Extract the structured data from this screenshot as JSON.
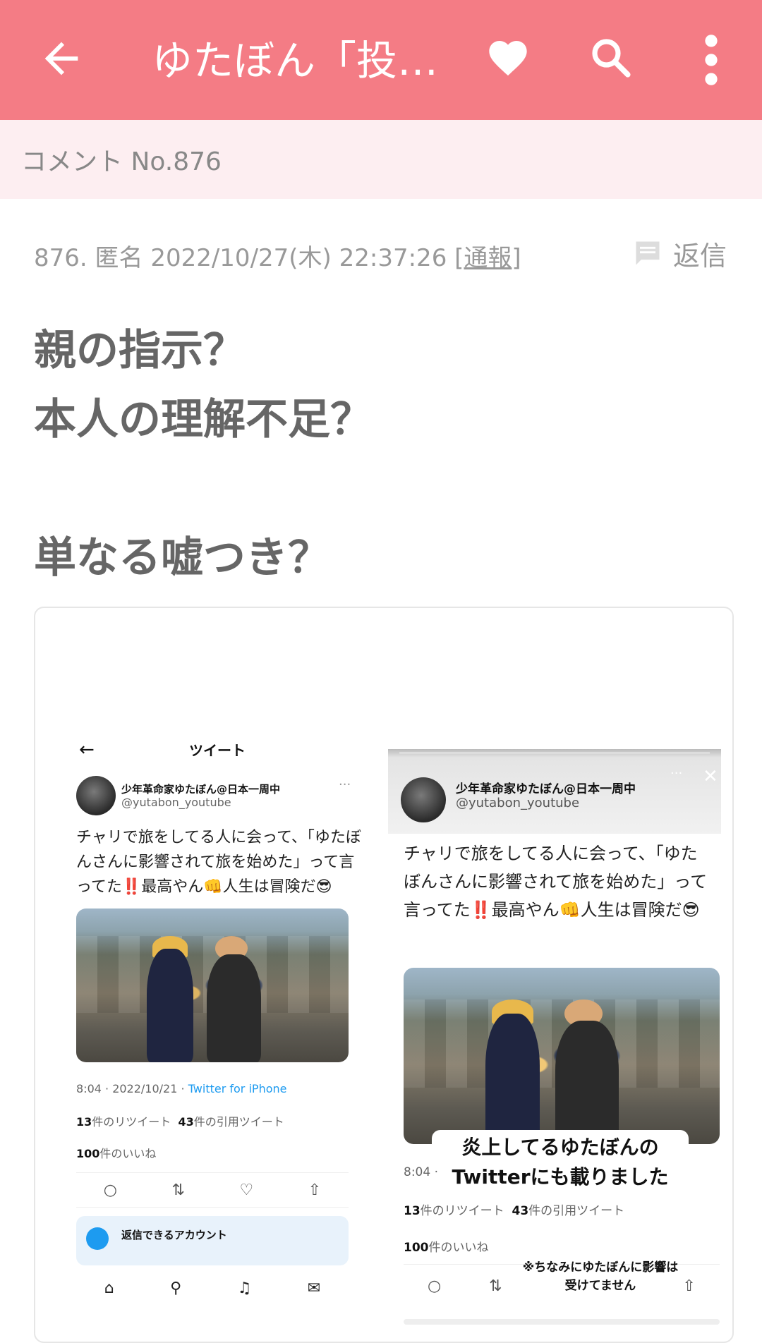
{
  "appbar": {
    "title": "ゆたぼん「投…",
    "bg_color": "#f47c85"
  },
  "subbar": {
    "label": "コメント No.876"
  },
  "comment": {
    "meta": "876. 匿名 2022/10/27(木) 22:37:26 ",
    "report_open": "[",
    "report": "通報",
    "report_close": "]",
    "reply_label": "返信",
    "lines": [
      "親の指示？",
      "本人の理解不足？",
      "",
      "単なる嘘つき？"
    ]
  },
  "left_tweet": {
    "header_back": "←",
    "header_title": "ツイート",
    "user_name": "少年革命家ゆたぼん@日本一周中",
    "handle": "@yutabon_youtube",
    "dots": "···",
    "text": "チャリで旅をしてる人に会って、「ゆたぼんさんに影響されて旅を始めた」って言ってた‼️最高やん👊人生は冒険だ😎",
    "time": "8:04 · 2022/10/21 · ",
    "source": "Twitter for iPhone",
    "retweets_n": "13",
    "retweets_label": "件のリツイート",
    "quotes_n": "43",
    "quotes_label": "件の引用ツイート",
    "likes_n": "100",
    "likes_label": "件のいいね",
    "reply_box": "返信できるアカウント"
  },
  "right_tweet": {
    "user_name": "少年革命家ゆたぼん@日本一周中",
    "handle": "@yutabon_youtube",
    "text": "チャリで旅をしてる人に会って、「ゆたぼんさんに影響されて旅を始めた」って言ってた‼️最高やん👊人生は冒険だ😎",
    "caption_line1": "炎上してるゆたぼんの",
    "caption_line2": "Twitterにも載りました",
    "time": "8:04 ·",
    "retweets_n": "13",
    "retweets_label": "件のリツイート",
    "quotes_n": "43",
    "quotes_label": "件の引用ツイート",
    "likes_n": "100",
    "likes_label": "件のいいね",
    "note_line1": "※ちなみにゆたぼんに影響は",
    "note_line2": "受けてません"
  }
}
